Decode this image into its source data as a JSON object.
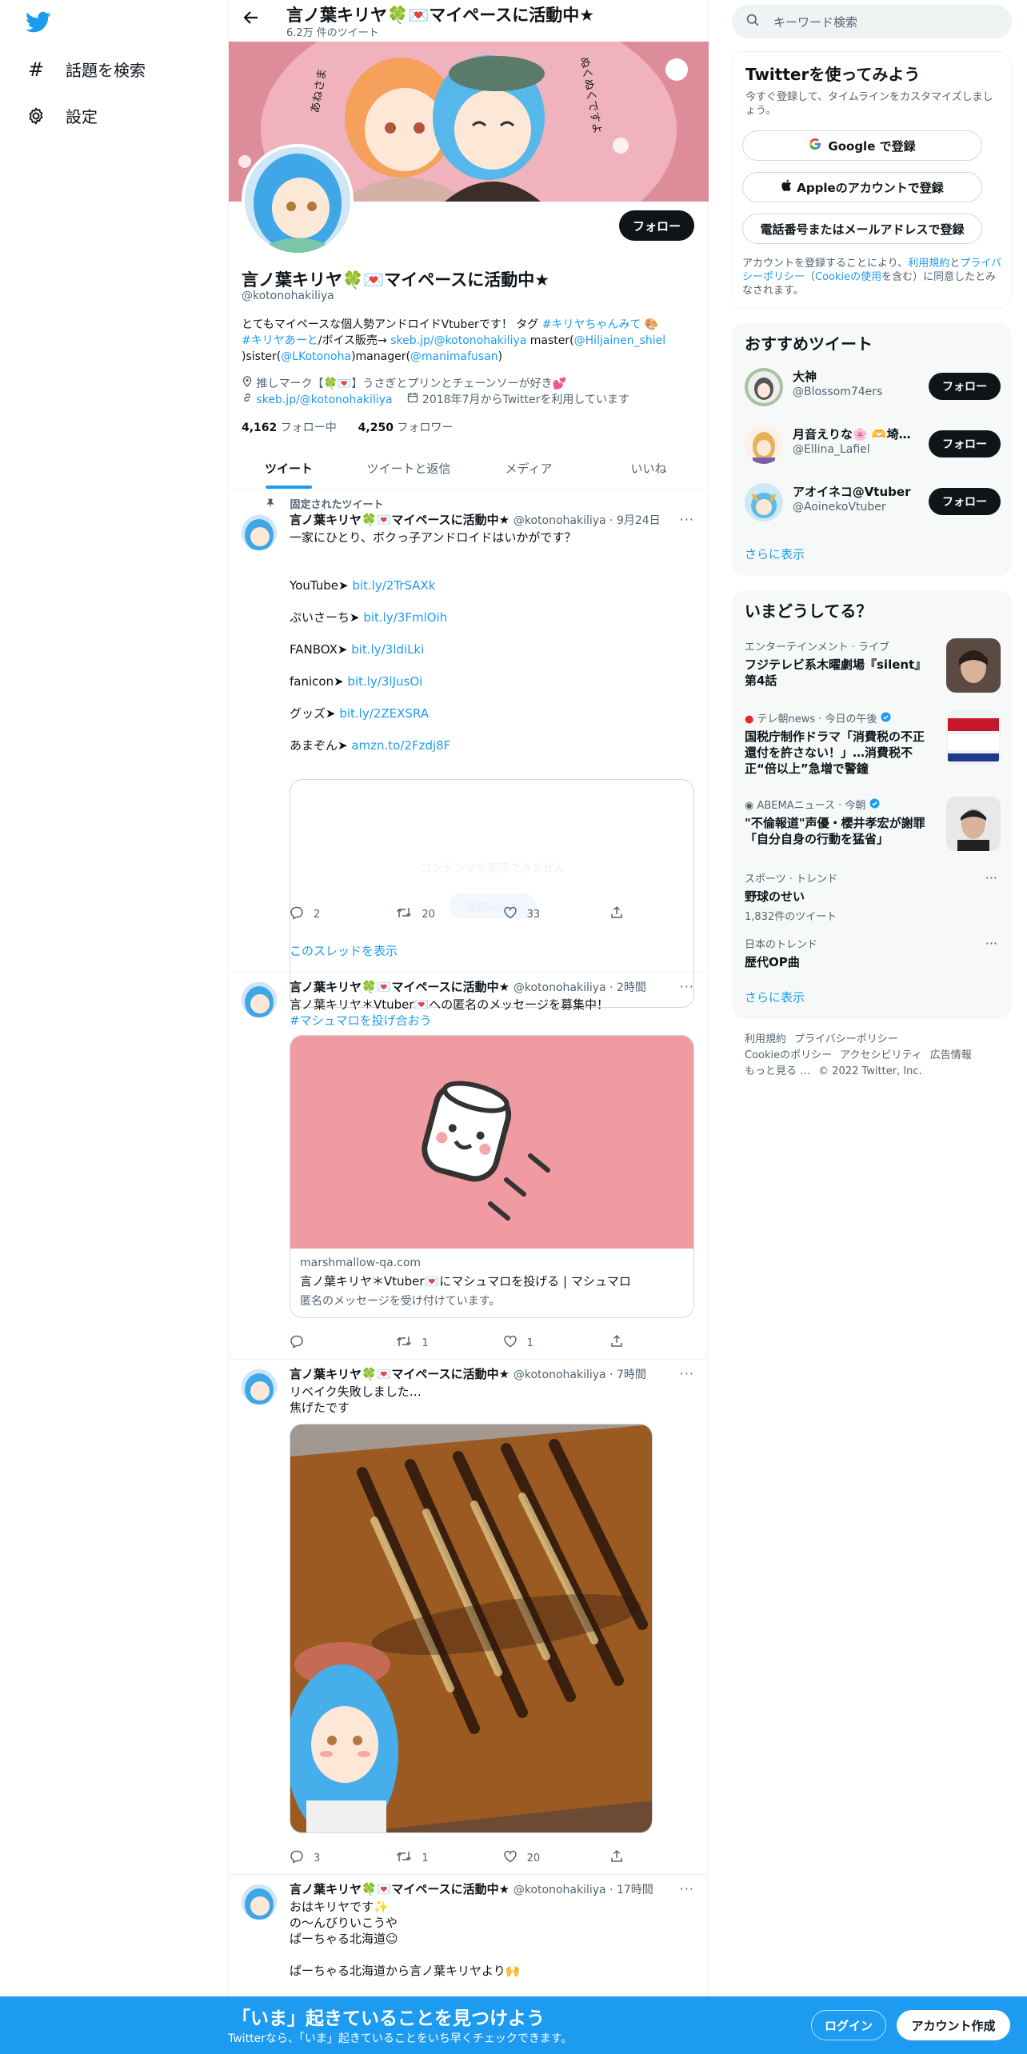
{
  "nav": {
    "explore_label": "話題を検索",
    "settings_label": "設定"
  },
  "header": {
    "title": "言ノ葉キリヤ🍀💌マイペースに活動中★",
    "tweet_count": "6.2万 件のツイート"
  },
  "profile": {
    "follow_label": "フォロー",
    "name": "言ノ葉キリヤ🍀💌マイペースに活動中★",
    "handle": "@kotonohakiliya",
    "bio_1": "とてもマイペースな個人勢アンドロイドVtuberです！ タグ ",
    "bio_tag1": "#キリヤちゃんみて",
    "bio_2": " 🎨",
    "bio_tag2": "#キリヤあーと",
    "bio_3": "/ボイス販売→ ",
    "bio_link1": "skeb.jp/@kotonohakiliya",
    "bio_4": " master(",
    "bio_link2": "@Hiljainen_shiel",
    "bio_5": ")sister(",
    "bio_link3": "@LKotonoha",
    "bio_6": ")manager(",
    "bio_link4": "@manimafusan",
    "bio_7": ")",
    "location": "推しマーク【🍀💌】うさぎとプリンとチェーンソーが好き💕",
    "website": "skeb.jp/@kotonohakiliya",
    "joined": "2018年7月からTwitterを利用しています",
    "following_count": "4,162",
    "following_label": "フォロー中",
    "followers_count": "4,250",
    "followers_label": "フォロワー"
  },
  "tabs": [
    "ツイート",
    "ツイートと返信",
    "メディア",
    "いいね"
  ],
  "tweets": [
    {
      "pinned_label": "固定されたツイート",
      "name": "言ノ葉キリヤ🍀💌マイペースに活動中★",
      "meta": "@kotonohakiliya · 9月24日",
      "text": "一家にひとり、ボクっ子アンドロイドはいかがです？",
      "links": [
        {
          "label": "YouTube➤ ",
          "url": "bit.ly/2TrSAXk"
        },
        {
          "label": "ぷいさーち➤ ",
          "url": "bit.ly/3FmlOih"
        },
        {
          "label": "FANBOX➤ ",
          "url": "bit.ly/3ldiLki"
        },
        {
          "label": "fanicon➤ ",
          "url": "bit.ly/3lJusOi"
        },
        {
          "label": "グッズ➤ ",
          "url": "bit.ly/2ZEXSRA"
        },
        {
          "label": "あまぞん➤ ",
          "url": "amzn.to/2Fzdj8F"
        }
      ],
      "embed_faded_text": "コンテンツを表示できません",
      "embed_faded_button": "再読み込み",
      "replies": "2",
      "retweets": "20",
      "likes": "33",
      "thread_label": "このスレッドを表示"
    },
    {
      "name": "言ノ葉キリヤ🍀💌マイペースに活動中★",
      "meta": "@kotonohakiliya · 2時間",
      "text": "言ノ葉キリヤ＊Vtuber💌への匿名のメッセージを募集中！",
      "hashtag": "#マシュマロを投げ合おう",
      "card_domain": "marshmallow-qa.com",
      "card_title": "言ノ葉キリヤ＊Vtuber💌にマシュマロを投げる | マシュマロ",
      "card_desc": "匿名のメッセージを受け付けています。",
      "replies": "",
      "retweets": "1",
      "likes": "1"
    },
    {
      "name": "言ノ葉キリヤ🍀💌マイペースに活動中★",
      "meta": "@kotonohakiliya · 7時間",
      "text": "リベイク失敗しました…\n焦げたです",
      "replies": "3",
      "retweets": "1",
      "likes": "20"
    },
    {
      "name": "言ノ葉キリヤ🍀💌マイペースに活動中★",
      "meta": "@kotonohakiliya · 17時間",
      "text": "おはキリヤです✨\nの～んびりいこうや\nぱーちゃる北海道☺\n\nぱーちゃる北海道から言ノ葉キリヤより🙌"
    }
  ],
  "search": {
    "placeholder": "キーワード検索"
  },
  "signup_card": {
    "title": "Twitterを使ってみよう",
    "subtitle": "今すぐ登録して、タイムラインをカスタマイズしましょう。",
    "google_label": "Google で登録",
    "apple_label": "Appleのアカウントで登録",
    "phone_label": "電話番号またはメールアドレスで登録",
    "terms_1": "アカウントを登録することにより、",
    "terms_link1": "利用規約",
    "terms_2": "と",
    "terms_link2": "プライバシーポリシー",
    "terms_3": "（",
    "terms_link3": "Cookieの使用",
    "terms_4": "を含む）に同意したとみなされます。"
  },
  "recommend": {
    "title": "おすすめツイート",
    "follow_label": "フォロー",
    "items": [
      {
        "name": "大神",
        "handle": "@Blossom74ers"
      },
      {
        "name": "月音えりな🌸 🫶埼…",
        "handle": "@Ellina_Lafiel"
      },
      {
        "name": "アオイネコ@Vtuber",
        "handle": "@AoinekoVtuber"
      }
    ],
    "more": "さらに表示"
  },
  "trends": {
    "title": "いまどうしてる？",
    "items": [
      {
        "context": "エンターテインメント · ライブ",
        "title": "フジテレビ系木曜劇場『silent』第4話"
      },
      {
        "context": "テレ朝news · 今日の午後",
        "title": "国税庁制作ドラマ「消費税の不正還付を許さない！」…消費税不正“倍以上”急増で警鐘"
      },
      {
        "context": "ABEMAニュース · 今朝",
        "title": "\"不倫報道\"声優・櫻井孝宏が謝罪「自分自身の行動を猛省」"
      },
      {
        "context": "スポーツ · トレンド",
        "title": "野球のせい",
        "count": "1,832件のツイート"
      },
      {
        "context": "日本のトレンド",
        "title": "歴代OP曲"
      }
    ],
    "more": "さらに表示"
  },
  "footer": {
    "items": [
      "利用規約",
      "プライバシーポリシー",
      "Cookieのポリシー",
      "アクセシビリティ",
      "広告情報",
      "もっと見る …",
      "© 2022 Twitter, Inc."
    ]
  },
  "bottombar": {
    "heading": "「いま」起きていることを見つけよう",
    "sub": "Twitterなら、「いま」起きていることをいち早くチェックできます。",
    "login": "ログイン",
    "signup": "アカウント作成"
  },
  "colors": {
    "accent": "#1d9bf0",
    "text": "#0f1419",
    "muted": "#536471",
    "marshmallow_card": "#f09aa1"
  }
}
